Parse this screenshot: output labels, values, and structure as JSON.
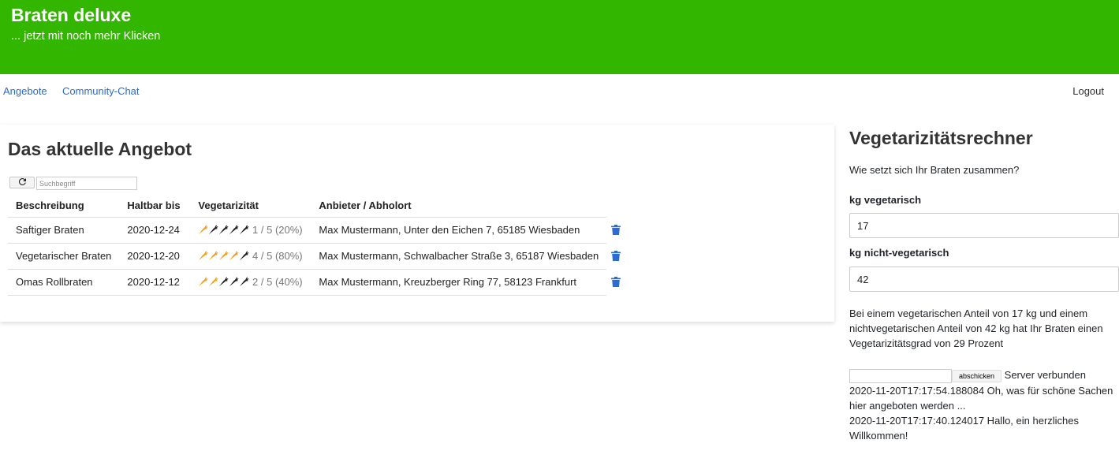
{
  "header": {
    "title": "Braten deluxe",
    "subtitle": "... jetzt mit noch mehr Klicken",
    "background": "#33b600"
  },
  "nav": {
    "items": [
      "Angebote",
      "Community-Chat"
    ],
    "logout": "Logout",
    "link_color": "#2a6ccf"
  },
  "offers": {
    "title": "Das aktuelle Angebot",
    "refresh_icon": "refresh-icon",
    "search_placeholder": "Suchbegriff",
    "columns": [
      "Beschreibung",
      "Haltbar bis",
      "Vegetarizität",
      "Anbieter / Abholort"
    ],
    "rows": [
      {
        "beschreibung": "Saftiger Braten",
        "haltbar": "2020-12-24",
        "veg_level": 1,
        "veg_max": 5,
        "veg_text": "1 / 5 (20%)",
        "anbieter": "Max Mustermann, Unter den Eichen 7, 65185 Wiesbaden"
      },
      {
        "beschreibung": "Vegetarischer Braten",
        "haltbar": "2020-12-20",
        "veg_level": 4,
        "veg_max": 5,
        "veg_text": "4 / 5 (80%)",
        "anbieter": "Max Mustermann, Schwalbacher Straße 3, 65187 Wiesbaden"
      },
      {
        "beschreibung": "Omas Rollbraten",
        "haltbar": "2020-12-12",
        "veg_level": 2,
        "veg_max": 5,
        "veg_text": "2 / 5 (40%)",
        "anbieter": "Max Mustermann, Kreuzberger Ring 77, 58123 Frankfurt"
      }
    ],
    "carrot_active_color": "#f39c12",
    "carrot_inactive_color": "#1a1a1a",
    "trash_color": "#2a6ccf"
  },
  "calculator": {
    "title": "Vegetarizitätsrechner",
    "question": "Wie setzt sich Ihr Braten zusammen?",
    "veg_label": "kg vegetarisch",
    "veg_value": "17",
    "nonveg_label": "kg nicht-vegetarisch",
    "nonveg_value": "42",
    "result": "Bei einem vegetarischen Anteil von 17 kg und einem nichtvegetarischen Anteil von 42 kg hat Ihr Braten einen Vegetarizitätsgrad von 29 Prozent"
  },
  "chat": {
    "send_label": "abschicken",
    "status": "Server verbunden",
    "messages": [
      "2020-11-20T17:17:54.188084 Oh, was für schöne Sachen hier angeboten werden ...",
      "2020-11-20T17:17:40.124017 Hallo, ein herzliches Willkommen!"
    ]
  }
}
